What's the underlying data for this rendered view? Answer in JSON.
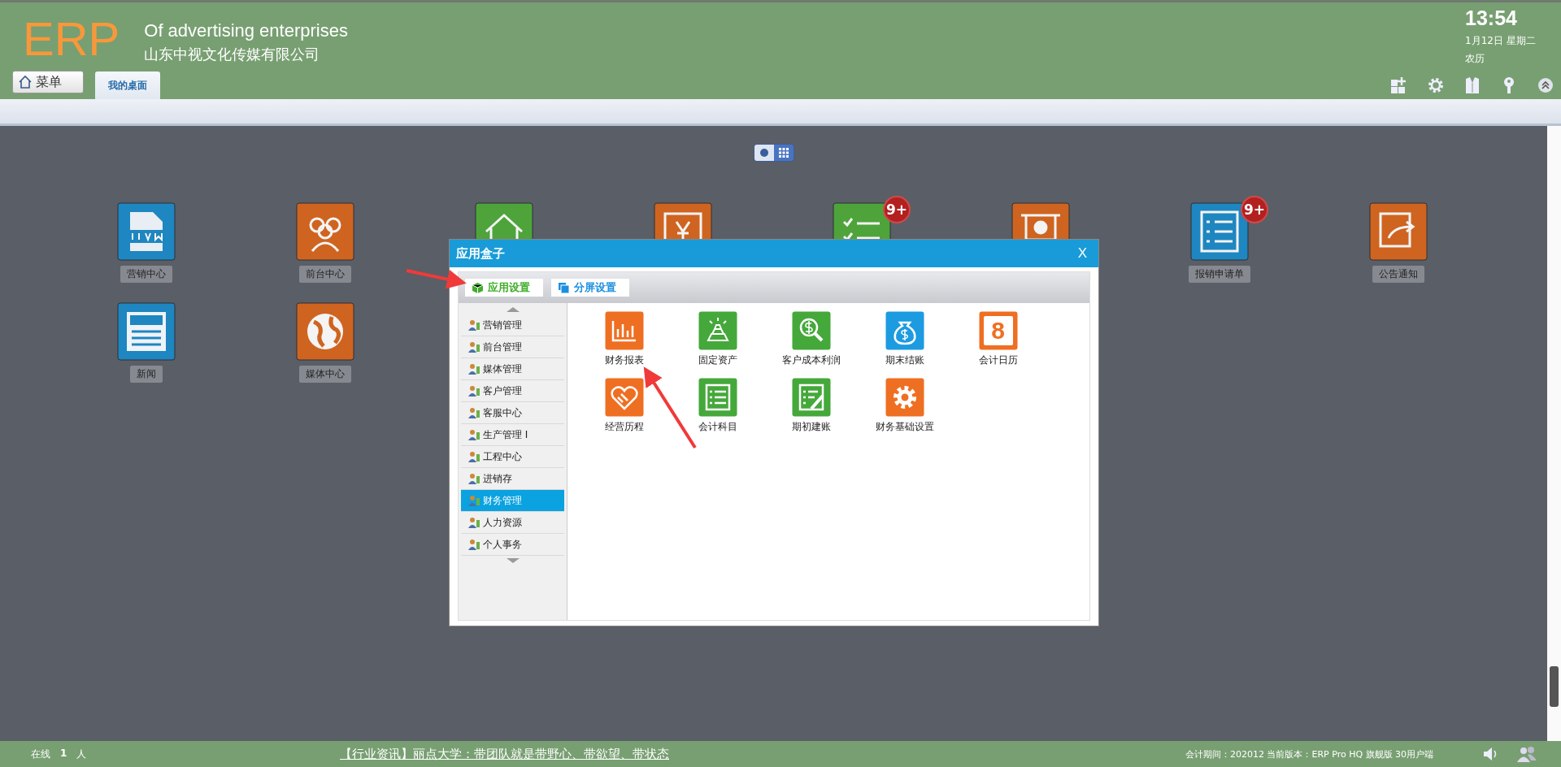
{
  "header": {
    "logo": "ERP",
    "title": "Of advertising enterprises",
    "company": "山东中视文化传媒有限公司",
    "menu_button": "菜单",
    "tabs": [
      {
        "label": "我的桌面",
        "selected": true
      }
    ],
    "clock": {
      "time": "13:54",
      "date": "1月12日 星期二",
      "lunar": "农历"
    }
  },
  "view_modes": [
    {
      "kind": "slider",
      "selected": false
    },
    {
      "kind": "grid",
      "selected": true
    }
  ],
  "desktop_icons": [
    {
      "kind": "crm",
      "label": "营销中心"
    },
    {
      "kind": "people",
      "label": "前台中心"
    },
    {
      "kind": "house"
    },
    {
      "kind": "yen"
    },
    {
      "kind": "checklist",
      "badge": "9+"
    },
    {
      "kind": "presentation"
    },
    {
      "kind": "list",
      "label": "报销申请单",
      "badge": "9+"
    },
    {
      "kind": "share",
      "label": "公告通知"
    },
    {
      "kind": "news",
      "label": "新闻"
    },
    {
      "kind": "globe",
      "label": "媒体中心"
    }
  ],
  "dialog": {
    "title": "应用盒子",
    "close": "X",
    "tabs": [
      {
        "label": "应用设置",
        "kind": "cube",
        "selected": true
      },
      {
        "label": "分屏设置",
        "kind": "windows",
        "selected": false
      }
    ],
    "sidebar": [
      {
        "label": "营销管理",
        "selected": false
      },
      {
        "label": "前台管理",
        "selected": false
      },
      {
        "label": "媒体管理",
        "selected": false
      },
      {
        "label": "客户管理",
        "selected": false
      },
      {
        "label": "客服中心",
        "selected": false
      },
      {
        "label": "生产管理 I",
        "selected": false
      },
      {
        "label": "工程中心",
        "selected": false
      },
      {
        "label": "进销存",
        "selected": false
      },
      {
        "label": "财务管理",
        "selected": true
      },
      {
        "label": "人力资源",
        "selected": false
      },
      {
        "label": "个人事务",
        "selected": false
      }
    ],
    "apps": [
      {
        "kind": "chart",
        "label": "财务报表"
      },
      {
        "kind": "gold",
        "label": "固定资产"
      },
      {
        "kind": "money-search",
        "label": "客户成本利润"
      },
      {
        "kind": "moneybag",
        "label": "期末结账"
      },
      {
        "kind": "calendar",
        "label": "会计日历",
        "text": "8"
      },
      {
        "kind": "handshake",
        "label": "经营历程"
      },
      {
        "kind": "list",
        "label": "会计科目"
      },
      {
        "kind": "edit-list",
        "label": "期初建账"
      },
      {
        "kind": "gear",
        "label": "财务基础设置"
      }
    ]
  },
  "footer": {
    "online_label": "在线",
    "online_count": "1",
    "online_unit": "人",
    "news": "【行业资讯】丽点大学：带团队就是带野心、带欲望、带状态",
    "info": "会计期间：202012 当前版本：ERP Pro HQ 旗舰版 30用户端"
  }
}
